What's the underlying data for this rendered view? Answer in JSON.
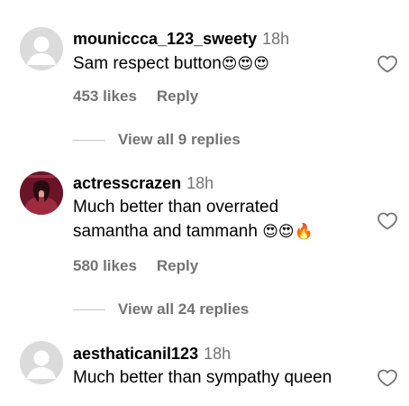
{
  "comments": [
    {
      "username": "mouniccca_123_sweety",
      "time": "18h",
      "text": "Sam respect button",
      "emoji": "😍😍😍",
      "likes": "453 likes",
      "reply_label": "Reply",
      "avatar": "default-avatar-icon",
      "view_replies": "View all 9 replies"
    },
    {
      "username": "actresscrazen",
      "time": "18h",
      "text_line1": "Much better than overrated",
      "text_line2": "samantha and tammanh",
      "emoji": "😍😍🔥",
      "likes": "580 likes",
      "reply_label": "Reply",
      "avatar": "profile-photo",
      "view_replies": "View all 24 replies"
    },
    {
      "username": "aesthaticanil123",
      "time": "18h",
      "text": "Much better than sympathy queen",
      "avatar": "default-avatar-icon"
    }
  ],
  "colors": {
    "secondary_text": "#737373",
    "divider": "#c7c7c7",
    "avatar_placeholder": "#dbdbdb"
  },
  "icons": {
    "like": "heart-outline-icon"
  }
}
